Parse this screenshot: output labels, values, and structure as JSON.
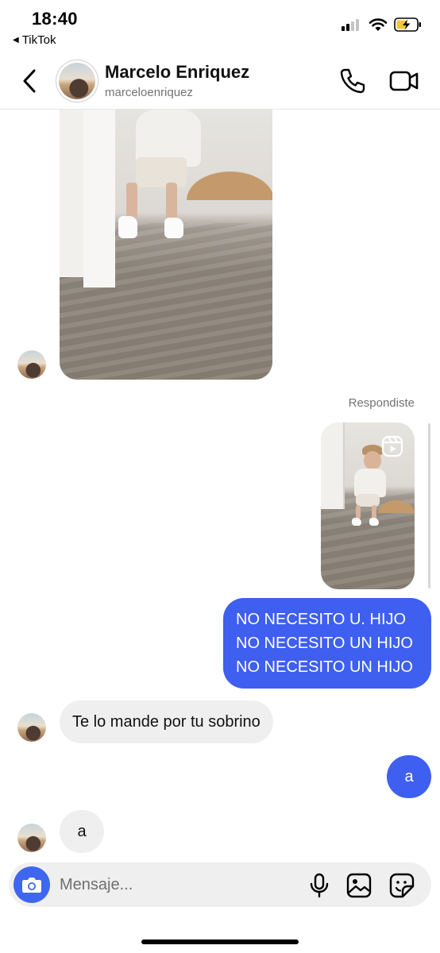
{
  "status_bar": {
    "time": "18:40",
    "back_app": "TikTok",
    "icons": [
      "signal-icon",
      "wifi-icon",
      "battery-charging-icon"
    ]
  },
  "header": {
    "contact_name": "Marcelo Enriquez",
    "contact_handle": "marceloenriquez",
    "icons": [
      "chevron-left-icon",
      "phone-icon",
      "video-camera-icon"
    ]
  },
  "conversation": {
    "reply_label": "Respondiste",
    "sent_text_lines": [
      "NO NECESITO U. HIJO",
      "NO NECESITO UN HIJO",
      "NO NECESITO UN HIJO"
    ],
    "received_text_1": "Te lo mande por tu sobrino",
    "sent_short": "a",
    "received_short": "a"
  },
  "composer": {
    "placeholder": "Mensaje...",
    "icons": [
      "camera-icon",
      "microphone-icon",
      "gallery-icon",
      "sticker-icon"
    ]
  },
  "colors": {
    "sent_bubble": "#3e5ff0",
    "received_bubble": "#efefef",
    "camera_button": "#3f66f0"
  }
}
